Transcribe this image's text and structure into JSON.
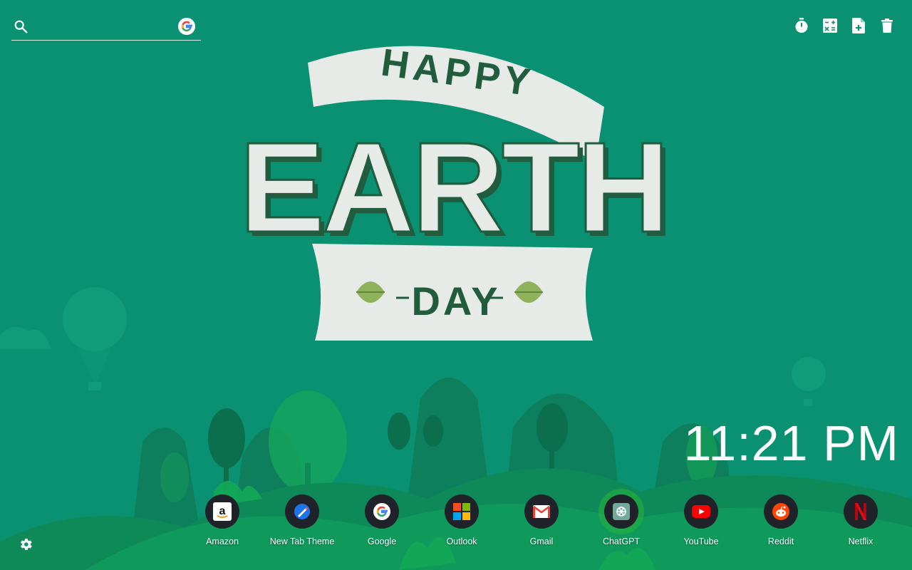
{
  "search": {
    "placeholder": "",
    "value": "",
    "engine": "google"
  },
  "toolbar": {
    "icons": [
      "timer-icon",
      "calculator-icon",
      "add-note-icon",
      "trash-icon"
    ]
  },
  "wallpaper": {
    "line1": "HAPPY",
    "line2": "EARTH",
    "line3": "DAY",
    "colors": {
      "background": "#0a9171",
      "banner": "#e6ebe7",
      "lettering": "#215c3f"
    }
  },
  "clock": {
    "time": "11:21 PM"
  },
  "shortcuts": [
    {
      "label": "Amazon",
      "icon": "amazon-icon"
    },
    {
      "label": "New Tab Theme",
      "icon": "new-tab-theme-icon"
    },
    {
      "label": "Google",
      "icon": "google-icon"
    },
    {
      "label": "Outlook",
      "icon": "outlook-icon"
    },
    {
      "label": "Gmail",
      "icon": "gmail-icon"
    },
    {
      "label": "ChatGPT",
      "icon": "chatgpt-icon"
    },
    {
      "label": "YouTube",
      "icon": "youtube-icon"
    },
    {
      "label": "Reddit",
      "icon": "reddit-icon"
    },
    {
      "label": "Netflix",
      "icon": "netflix-icon"
    }
  ],
  "settings": {
    "icon": "gear-icon"
  }
}
